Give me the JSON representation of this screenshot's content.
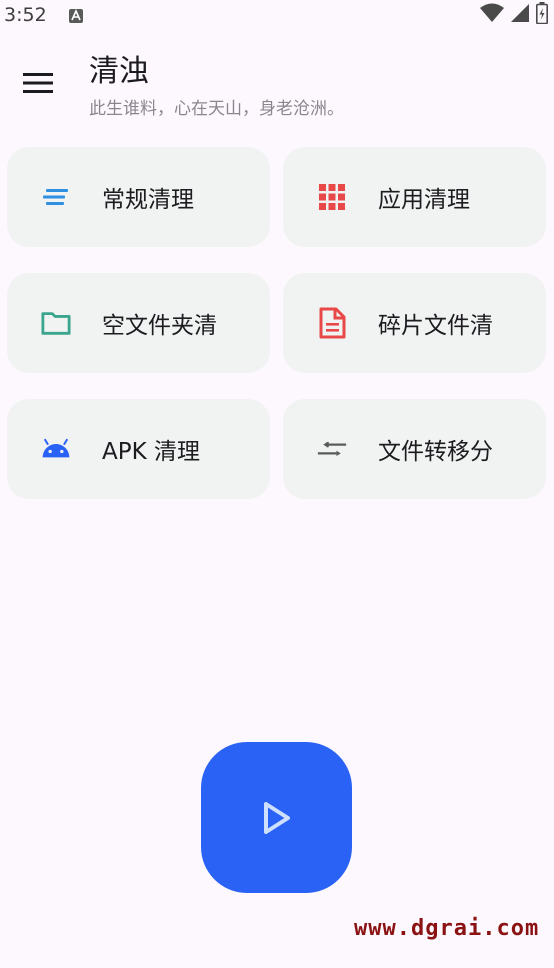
{
  "status_bar": {
    "time": "3:52"
  },
  "app_bar": {
    "title": "清浊",
    "subtitle": "此生谁料，心在天山，身老沧洲。"
  },
  "cards": [
    {
      "label": "常规清理",
      "icon": "lines-icon",
      "color": "#2f8fe0"
    },
    {
      "label": "应用清理",
      "icon": "apps-grid-icon",
      "color": "#e84848"
    },
    {
      "label": "空文件夹清",
      "icon": "folder-icon",
      "color": "#3aa58c"
    },
    {
      "label": "碎片文件清",
      "icon": "document-icon",
      "color": "#e84848"
    },
    {
      "label": "APK 清理",
      "icon": "android-icon",
      "color": "#2a62f5"
    },
    {
      "label": "文件转移分",
      "icon": "transfer-arrows-icon",
      "color": "#5a5a5a"
    }
  ],
  "fab": {
    "icon": "play-icon",
    "color": "#2a62f5"
  },
  "watermark": "www.dgrai.com"
}
